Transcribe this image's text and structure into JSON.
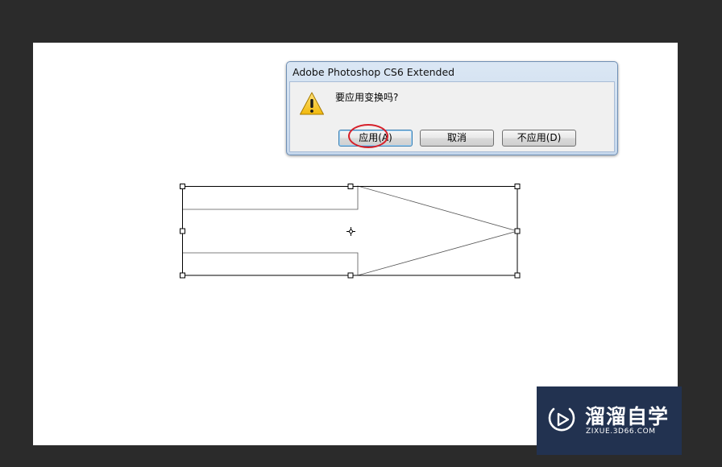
{
  "dialog": {
    "title": "Adobe Photoshop CS6 Extended",
    "message": "要应用变换吗?",
    "buttons": {
      "apply": "应用(A)",
      "cancel": "取消",
      "dont_apply": "不应用(D)"
    },
    "icon": "warning-icon"
  },
  "transform": {
    "handles": 8,
    "center_icon": "crosshair-icon"
  },
  "watermark": {
    "text": "溜溜自学",
    "url": "ZIXUE.3D66.COM",
    "icon": "play-logo-icon"
  },
  "colors": {
    "workspace": "#2b2b2b",
    "canvas": "#ffffff",
    "highlight_circle": "#d6202a",
    "watermark_bg": "#223250"
  }
}
